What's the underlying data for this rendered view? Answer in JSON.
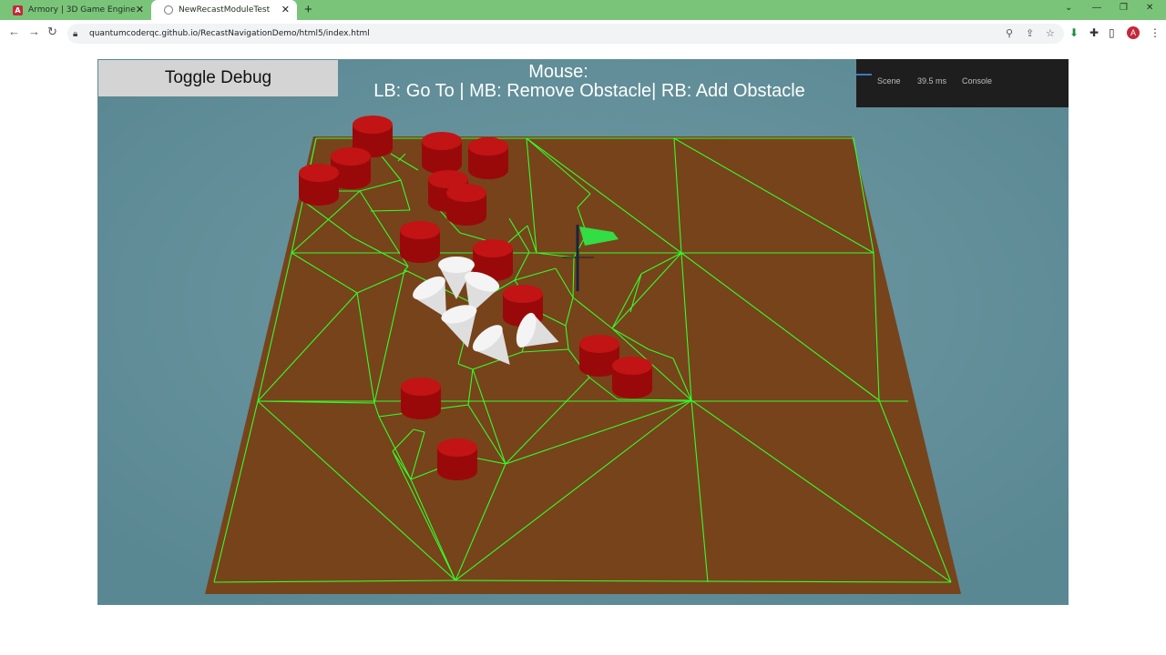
{
  "browser": {
    "tabs": [
      {
        "title": "Armory | 3D Game Engine",
        "favicon": "A",
        "active": false
      },
      {
        "title": "NewRecastModuleTest",
        "active": true
      }
    ],
    "url": "quantumcoderqc.github.io/RecastNavigationDemo/html5/index.html"
  },
  "app": {
    "toggle_debug_label": "Toggle Debug",
    "mouse_label": "Mouse:",
    "controls_hint": "LB: Go To | MB: Remove Obstacle| RB: Add Obstacle",
    "debug_panel": {
      "scene_tab": "Scene",
      "frame_time": "39.5 ms",
      "console_tab": "Console"
    }
  },
  "colors": {
    "background": "#5e8c97",
    "ground": "#77431b",
    "navmesh_lines": "#32ff2a",
    "obstacles": "#a50a0a",
    "agents": "#f0f0f0",
    "goal_flag": "#33dd44",
    "tab_strip": "#7ac47a"
  },
  "icons": [
    "back-icon",
    "forward-icon",
    "reload-icon",
    "lock-icon",
    "zoom-icon",
    "share-icon",
    "star-icon",
    "download-icon",
    "extensions-icon",
    "sidebar-icon",
    "profile-icon",
    "menu-icon"
  ]
}
